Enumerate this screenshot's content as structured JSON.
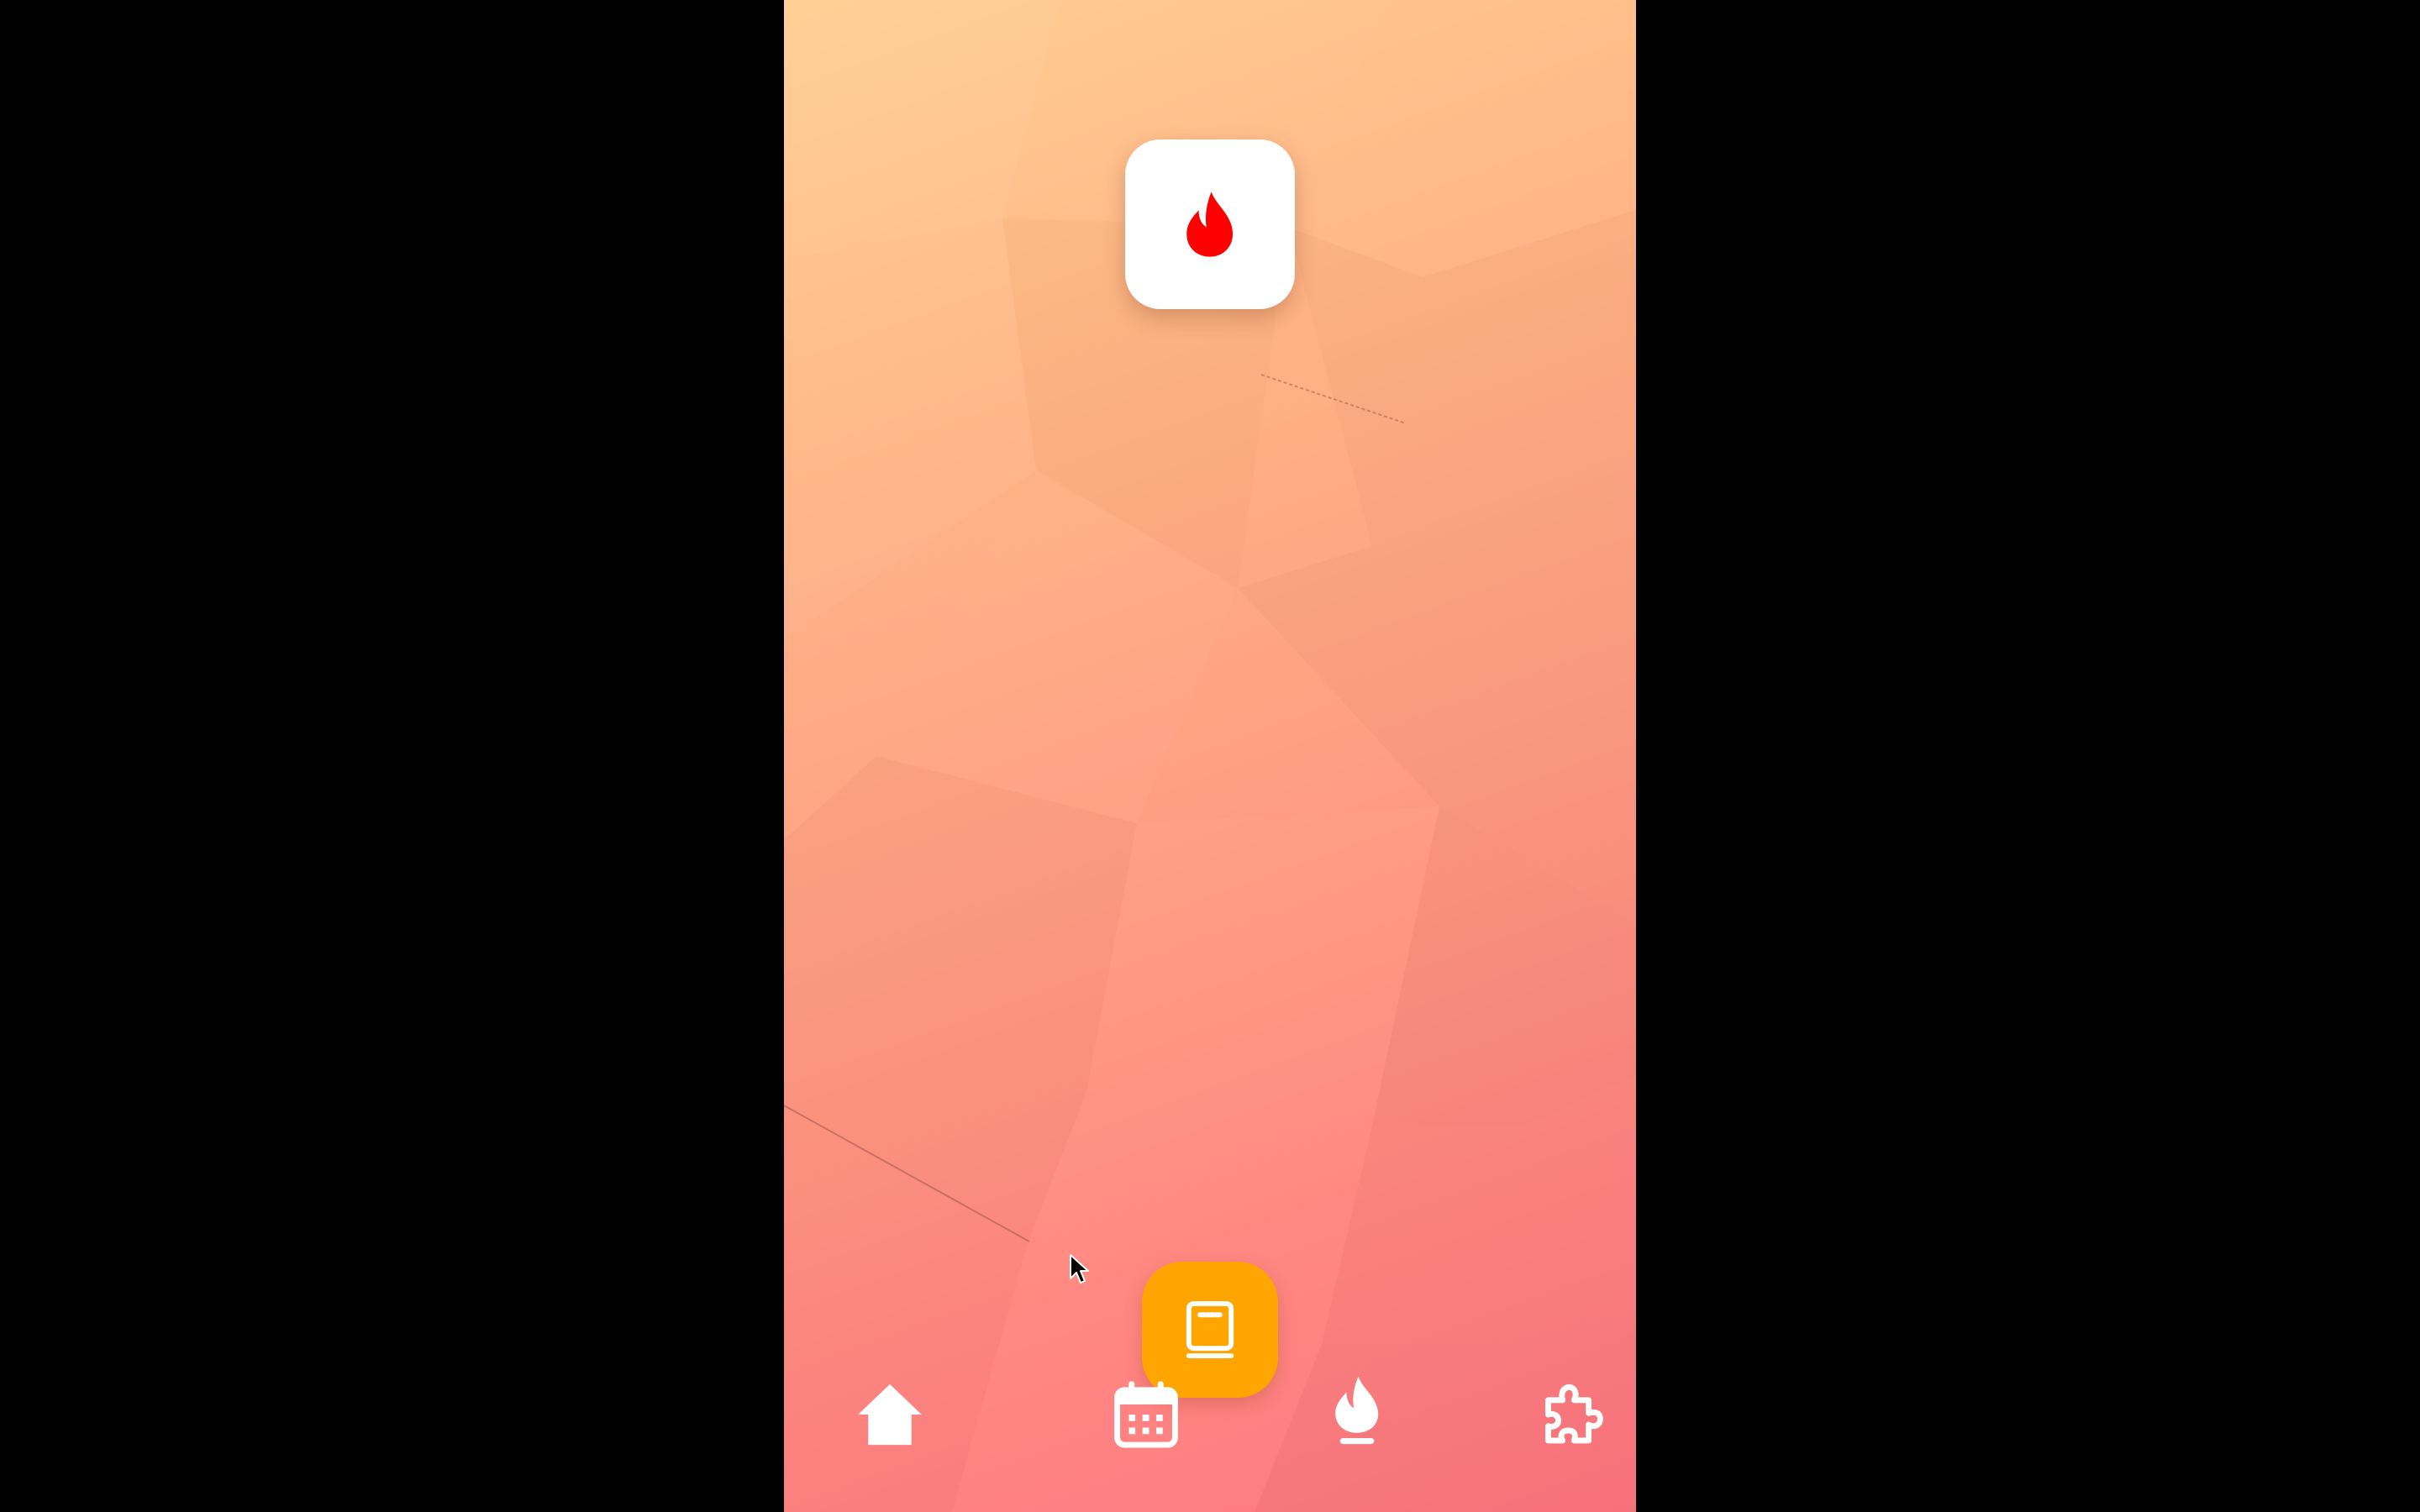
{
  "screen": {
    "background_color": "#000000"
  },
  "phone": {
    "gradient_colors": [
      "#ffcd8f",
      "#ffb384",
      "#ff9c82",
      "#ff8680",
      "#ff757f"
    ]
  },
  "app_tile": {
    "icon": "fire-icon",
    "icon_color": "#ff0000",
    "background_color": "#ffffff"
  },
  "fab": {
    "icon": "book-icon",
    "background_color": "#ffa500",
    "icon_color": "#ffffff"
  },
  "bottom_nav": {
    "items": [
      {
        "icon": "home-icon",
        "active": false
      },
      {
        "icon": "calendar-icon",
        "active": false
      },
      {
        "icon": "fire-icon",
        "active": true
      },
      {
        "icon": "puzzle-icon",
        "active": false
      }
    ],
    "icon_color": "#ffffff"
  }
}
